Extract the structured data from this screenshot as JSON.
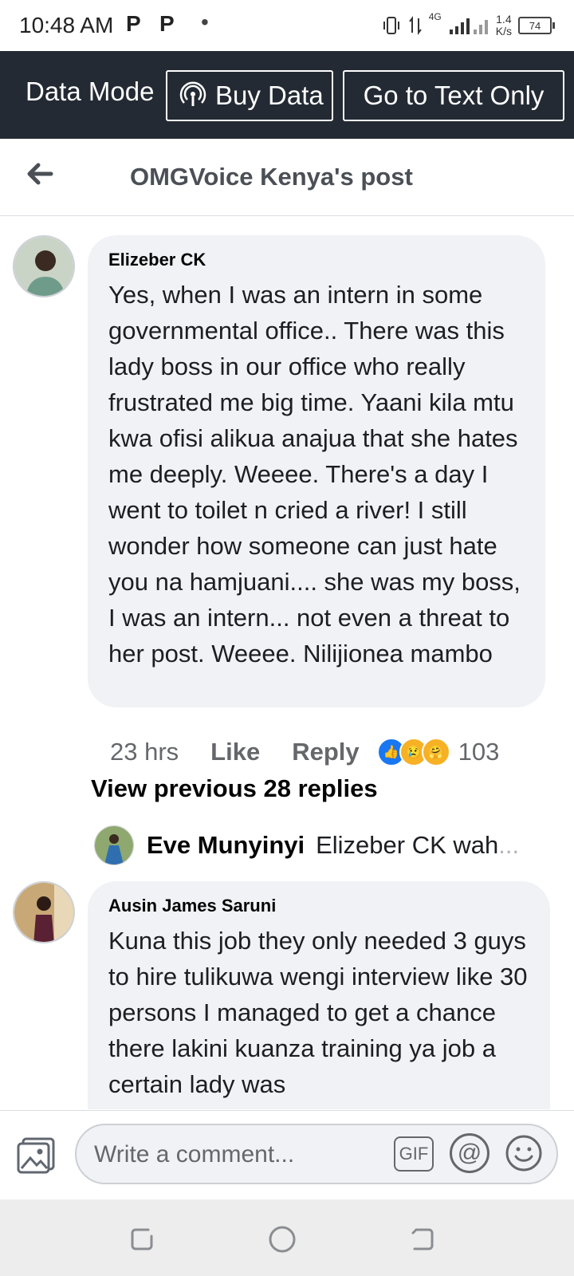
{
  "status_bar": {
    "time": "10:48 AM",
    "notif_1": "P",
    "notif_2": "P",
    "dot": "•",
    "network": "4G",
    "speed_value": "1.4",
    "speed_unit": "K/s",
    "battery": "74"
  },
  "banner": {
    "label": "Data Mode",
    "buy_data": "Buy Data",
    "text_only": "Go to Text Only"
  },
  "header": {
    "title": "OMGVoice Kenya's post"
  },
  "comments": [
    {
      "author": "Elizeber CK",
      "text": "Yes, when I was an intern in some governmental office.. There was this lady boss in our office who really frustrated me big time. Yaani kila mtu kwa ofisi alikua anajua that she hates me deeply. Weeee. There's a day I went to toilet n cried a river! I still wonder how someone can just hate you na hamjuani.... she was my boss, I was an intern... not even a threat to her post. Weeee. Nilijionea mambo",
      "time": "23 hrs",
      "like_label": "Like",
      "reply_label": "Reply",
      "reaction_count": "103"
    },
    {
      "author": "Ausin James Saruni",
      "text": "Kuna this job they only needed 3 guys to  hire tulikuwa wengi interview like 30 persons I managed to get a chance there lakini kuanza training ya job a certain lady was"
    }
  ],
  "replies": {
    "view_previous": "View previous 28 replies",
    "latest_author": "Eve Munyinyi",
    "latest_snippet": "Elizeber CK wah",
    "ellipsis": "..."
  },
  "composer": {
    "placeholder": "Write a comment...",
    "gif_label": "GIF",
    "at_label": "@"
  },
  "colors": {
    "banner_bg": "#232a33",
    "bubble_bg": "#f0f2f5",
    "like_blue": "#1877f2"
  }
}
